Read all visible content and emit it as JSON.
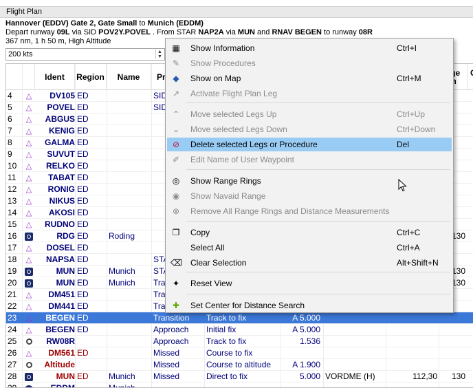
{
  "window": {
    "title": "Flight Plan"
  },
  "header": {
    "line1": {
      "from": "Hannover (EDDV)",
      "t1": " Gate 2, Gate Small ",
      "t2": "to",
      "to": " Munich (EDDM)"
    },
    "line2": {
      "p1": "Depart runway ",
      "rwy1": "09L",
      "p2": " via SID ",
      "sid": "POV2Y.POVEL",
      "p3": " . From STAR ",
      "star": "NAP2A",
      "p4": " via ",
      "via": "MUN",
      "p5": " and ",
      "rnav": "RNAV BEGEN",
      "p6": " to runway ",
      "rwy2": "08R"
    },
    "line3": "367 nm, 1 h 50 m, High Altitude"
  },
  "speed": {
    "value": "200 kts"
  },
  "columns": {
    "ident": "Ident",
    "region": "Region",
    "name": "Name",
    "proc": "Pr",
    "range": "nge",
    "range2": "m",
    "c": "C"
  },
  "rows": [
    {
      "num": "4",
      "icon": "triangle",
      "ident": "DV105",
      "region": "ED",
      "name": "",
      "proc": "SID",
      "type": "",
      "alt": "",
      "rest": "",
      "freq": "",
      "rng": ""
    },
    {
      "num": "5",
      "icon": "triangle",
      "ident": "POVEL",
      "region": "ED",
      "name": "",
      "proc": "SID",
      "type": "",
      "alt": "",
      "rest": "",
      "freq": "",
      "rng": ""
    },
    {
      "num": "6",
      "icon": "triangle",
      "ident": "ABGUS",
      "region": "ED",
      "name": "",
      "proc": "",
      "type": "",
      "alt": "",
      "rest": "",
      "freq": "",
      "rng": ""
    },
    {
      "num": "7",
      "icon": "triangle",
      "ident": "KENIG",
      "region": "ED",
      "name": "",
      "proc": "",
      "type": "",
      "alt": "",
      "rest": "",
      "freq": "",
      "rng": ""
    },
    {
      "num": "8",
      "icon": "triangle",
      "ident": "GALMA",
      "region": "ED",
      "name": "",
      "proc": "",
      "type": "",
      "alt": "",
      "rest": "",
      "freq": "",
      "rng": ""
    },
    {
      "num": "9",
      "icon": "triangle",
      "ident": "SUVUT",
      "region": "ED",
      "name": "",
      "proc": "",
      "type": "",
      "alt": "",
      "rest": "",
      "freq": "",
      "rng": ""
    },
    {
      "num": "10",
      "icon": "triangle",
      "ident": "RELKO",
      "region": "ED",
      "name": "",
      "proc": "",
      "type": "",
      "alt": "",
      "rest": "",
      "freq": "",
      "rng": ""
    },
    {
      "num": "11",
      "icon": "triangle",
      "ident": "TABAT",
      "region": "ED",
      "name": "",
      "proc": "",
      "type": "",
      "alt": "",
      "rest": "",
      "freq": "",
      "rng": ""
    },
    {
      "num": "12",
      "icon": "triangle",
      "ident": "RONIG",
      "region": "ED",
      "name": "",
      "proc": "",
      "type": "",
      "alt": "",
      "rest": "",
      "freq": "",
      "rng": ""
    },
    {
      "num": "13",
      "icon": "triangle",
      "ident": "NIKUS",
      "region": "ED",
      "name": "",
      "proc": "",
      "type": "",
      "alt": "",
      "rest": "",
      "freq": "",
      "rng": ""
    },
    {
      "num": "14",
      "icon": "triangle",
      "ident": "AKOSI",
      "region": "ED",
      "name": "",
      "proc": "",
      "type": "",
      "alt": "",
      "rest": "",
      "freq": "",
      "rng": ""
    },
    {
      "num": "15",
      "icon": "triangle",
      "ident": "RUDNO",
      "region": "ED",
      "name": "",
      "proc": "",
      "type": "",
      "alt": "",
      "rest": "",
      "freq": "",
      "rng": ""
    },
    {
      "num": "16",
      "icon": "ndb",
      "ident": "RDG",
      "region": "ED",
      "name": "Roding",
      "proc": "",
      "type": "",
      "alt": "",
      "rest": "",
      "freq": "",
      "rng": "130"
    },
    {
      "num": "17",
      "icon": "triangle",
      "ident": "DOSEL",
      "region": "ED",
      "name": "",
      "proc": "",
      "type": "",
      "alt": "",
      "rest": "",
      "freq": "",
      "rng": ""
    },
    {
      "num": "18",
      "icon": "triangle",
      "ident": "NAPSA",
      "region": "ED",
      "name": "",
      "proc": "STA",
      "type": "",
      "alt": "",
      "rest": "",
      "freq": "",
      "rng": ""
    },
    {
      "num": "19",
      "icon": "ndb",
      "ident": "MUN",
      "region": "ED",
      "name": "Munich",
      "proc": "STA",
      "type": "",
      "alt": "",
      "rest": "",
      "freq": "",
      "rng": "130"
    },
    {
      "num": "20",
      "icon": "ndb",
      "ident": "MUN",
      "region": "ED",
      "name": "Munich",
      "proc": "Tran",
      "type": "",
      "alt": "",
      "rest": "",
      "freq": "",
      "rng": "130"
    },
    {
      "num": "21",
      "icon": "triangle",
      "ident": "DM451",
      "region": "ED",
      "name": "",
      "proc": "Tran",
      "type": "",
      "alt": "",
      "rest": "",
      "freq": "",
      "rng": ""
    },
    {
      "num": "22",
      "icon": "triangle",
      "ident": "DM441",
      "region": "ED",
      "name": "",
      "proc": "Tran",
      "type": "",
      "alt": "",
      "rest": "",
      "freq": "",
      "rng": ""
    },
    {
      "num": "23",
      "icon": "triangle",
      "ident": "BEGEN",
      "region": "ED",
      "name": "",
      "proc": "Transition",
      "type": "Track to fix",
      "alt": "A 5.000",
      "rest": "",
      "freq": "",
      "rng": "",
      "selected": true
    },
    {
      "num": "24",
      "icon": "triangle",
      "ident": "BEGEN",
      "region": "ED",
      "name": "",
      "proc": "Approach",
      "type": "Initial fix",
      "alt": "A 5.000",
      "rest": "",
      "freq": "",
      "rng": ""
    },
    {
      "num": "25",
      "icon": "ring",
      "ident": "RW08R",
      "region": "",
      "name": "",
      "proc": "Approach",
      "type": "Track to fix",
      "alt": "1.536",
      "rest": "",
      "freq": "",
      "rng": ""
    },
    {
      "num": "26",
      "icon": "triangle",
      "ident": "DM561",
      "region": "ED",
      "name": "",
      "proc": "Missed",
      "type": "Course to fix",
      "alt": "",
      "rest": "",
      "freq": "",
      "rng": "",
      "missed": true
    },
    {
      "num": "27",
      "icon": "ring",
      "ident": "Altitude",
      "region": "",
      "name": "",
      "proc": "Missed",
      "type": "Course to altitude",
      "alt": "A 1.900",
      "rest": "",
      "freq": "",
      "rng": "",
      "missed": true
    },
    {
      "num": "28",
      "icon": "ndb",
      "ident": "MUN",
      "region": "ED",
      "name": "Munich",
      "proc": "Missed",
      "type": "Direct to fix",
      "alt": "5.000",
      "rest": "VORDME (H)",
      "freq": "112,30",
      "rng": "130",
      "missed": true
    },
    {
      "num": "29",
      "icon": "airport",
      "ident": "EDDM",
      "region": "",
      "name": "Munich",
      "proc": "",
      "type": "",
      "alt": "",
      "rest": "",
      "freq": "",
      "rng": ""
    }
  ],
  "context_menu": {
    "items": [
      {
        "icon": "info-icon",
        "glyph": "▦",
        "label": "Show Information",
        "shortcut": "Ctrl+I",
        "disabled": false
      },
      {
        "icon": "procedures-icon",
        "glyph": "✎",
        "label": "Show Procedures",
        "shortcut": "",
        "disabled": true
      },
      {
        "icon": "map-icon",
        "glyph": "◆",
        "label": "Show on Map",
        "shortcut": "Ctrl+M",
        "disabled": false
      },
      {
        "icon": "activate-leg-icon",
        "glyph": "↗",
        "label": "Activate Flight Plan Leg",
        "shortcut": "",
        "disabled": true
      },
      {
        "icon": "move-up-icon",
        "glyph": "⌃",
        "label": "Move selected Legs Up",
        "shortcut": "Ctrl+Up",
        "disabled": true
      },
      {
        "icon": "move-down-icon",
        "glyph": "⌄",
        "label": "Move selected Legs Down",
        "shortcut": "Ctrl+Down",
        "disabled": true
      },
      {
        "icon": "delete-icon",
        "glyph": "⊘",
        "label": "Delete selected Legs or Procedure",
        "shortcut": "Del",
        "disabled": false,
        "highlighted": true
      },
      {
        "icon": "edit-name-icon",
        "glyph": "✐",
        "label": "Edit Name of User Waypoint",
        "shortcut": "",
        "disabled": true
      },
      {
        "icon": "range-rings-icon",
        "glyph": "◎",
        "label": "Show Range Rings",
        "shortcut": "",
        "disabled": false
      },
      {
        "icon": "navaid-range-icon",
        "glyph": "◉",
        "label": "Show Navaid Range",
        "shortcut": "",
        "disabled": true
      },
      {
        "icon": "remove-rings-icon",
        "glyph": "⊗",
        "label": "Remove All Range Rings and Distance Measurements",
        "shortcut": "",
        "disabled": true
      },
      {
        "icon": "copy-icon",
        "glyph": "❐",
        "label": "Copy",
        "shortcut": "Ctrl+C",
        "disabled": false
      },
      {
        "icon": "",
        "glyph": "",
        "label": "Select All",
        "shortcut": "Ctrl+A",
        "disabled": false
      },
      {
        "icon": "clear-selection-icon",
        "glyph": "⌫",
        "label": "Clear Selection",
        "shortcut": "Alt+Shift+N",
        "disabled": false
      },
      {
        "icon": "reset-view-icon",
        "glyph": "✦",
        "label": "Reset View",
        "shortcut": "",
        "disabled": false
      },
      {
        "icon": "center-distance-icon",
        "glyph": "✚",
        "label": "Set Center for Distance Search",
        "shortcut": "",
        "disabled": false
      }
    ]
  },
  "colors": {
    "selection": "#3c78d8",
    "menu_highlight": "#99ccf5",
    "waypoint": "#9a32c8",
    "missed": "#a00000"
  }
}
